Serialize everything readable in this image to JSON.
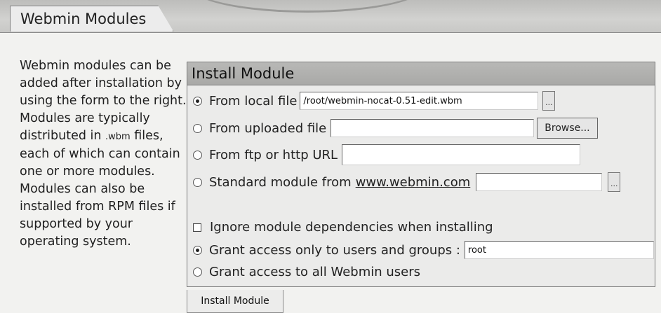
{
  "tab": {
    "title": "Webmin Modules"
  },
  "description": {
    "before_ext": "Webmin modules can be added after installation by using the form to the right. Modules are typically distributed in ",
    "ext": ".wbm",
    "after_ext": " files, each of which can contain one or more modules. Modules can also be installed from RPM files if supported by your operating system."
  },
  "install": {
    "header": "Install Module",
    "local_file_label": "From local file",
    "local_file_value": "/root/webmin-nocat-0.51-edit.wbm",
    "picker_label": "...",
    "uploaded_file_label": "From uploaded file",
    "uploaded_file_value": "",
    "browse_label": "Browse...",
    "url_label": "From ftp or http URL",
    "url_value": "",
    "standard_label": "Standard module from",
    "standard_link": "www.webmin.com",
    "standard_value": "",
    "ignore_deps_label": "Ignore module dependencies when installing",
    "grant_users_label": "Grant access only to users and groups :",
    "grant_users_value": "root",
    "grant_all_label": "Grant access to all Webmin users",
    "submit_label": "Install Module"
  }
}
